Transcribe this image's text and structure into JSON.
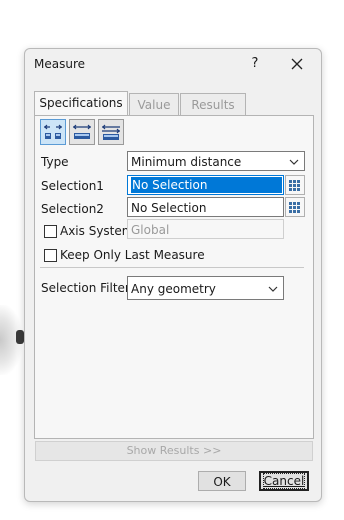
{
  "dialog": {
    "title": "Measure",
    "help_label": "?"
  },
  "tabs": [
    {
      "label": "Specifications",
      "active": true
    },
    {
      "label": "Value",
      "active": false
    },
    {
      "label": "Results",
      "active": false
    }
  ],
  "mode_icons": [
    "measure-between-icon",
    "measure-item-icon",
    "measure-thickness-icon"
  ],
  "type": {
    "label": "Type",
    "value": "Minimum distance"
  },
  "selection1": {
    "label": "Selection1",
    "value": "No Selection"
  },
  "selection2": {
    "label": "Selection2",
    "value": "No Selection"
  },
  "axis_system": {
    "label": "Axis System",
    "value": "Global",
    "checked": false
  },
  "keep_only_last": {
    "label": "Keep Only Last Measure",
    "checked": false
  },
  "selection_filter": {
    "label": "Selection Filter",
    "value": "Any geometry"
  },
  "show_results_label": "Show Results >>",
  "ok_label": "OK",
  "cancel_label": "Cancel",
  "colors": {
    "accent": "#0078d7",
    "window_bg": "#f0f0f0"
  }
}
